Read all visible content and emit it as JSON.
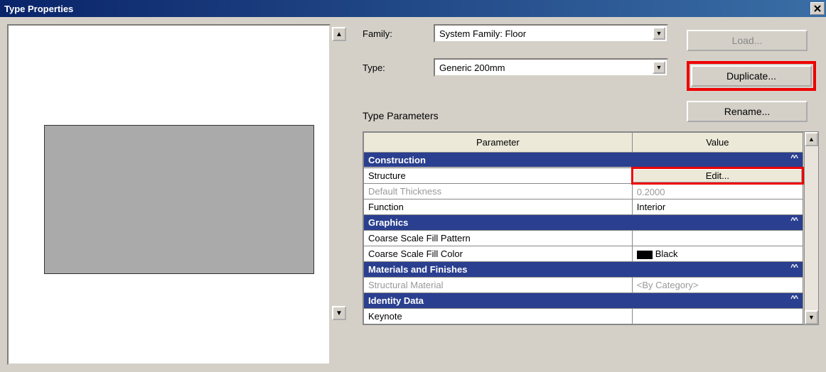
{
  "title": "Type Properties",
  "labels": {
    "family": "Family:",
    "type": "Type:",
    "typeParams": "Type Parameters"
  },
  "dropdowns": {
    "family": "System Family: Floor",
    "type": "Generic 200mm"
  },
  "buttons": {
    "load": "Load...",
    "duplicate": "Duplicate...",
    "rename": "Rename...",
    "edit": "Edit..."
  },
  "headers": {
    "parameter": "Parameter",
    "value": "Value"
  },
  "groups": {
    "construction": "Construction",
    "graphics": "Graphics",
    "materials": "Materials and Finishes",
    "identity": "Identity Data"
  },
  "params": {
    "structure": "Structure",
    "defaultThickness": "Default Thickness",
    "defaultThicknessVal": "0.2000",
    "function": "Function",
    "functionVal": "Interior",
    "coarsePattern": "Coarse Scale Fill Pattern",
    "coarseColor": "Coarse Scale Fill Color",
    "coarseColorVal": "Black",
    "structuralMat": "Structural Material",
    "structuralMatVal": "<By Category>",
    "keynote": "Keynote"
  }
}
